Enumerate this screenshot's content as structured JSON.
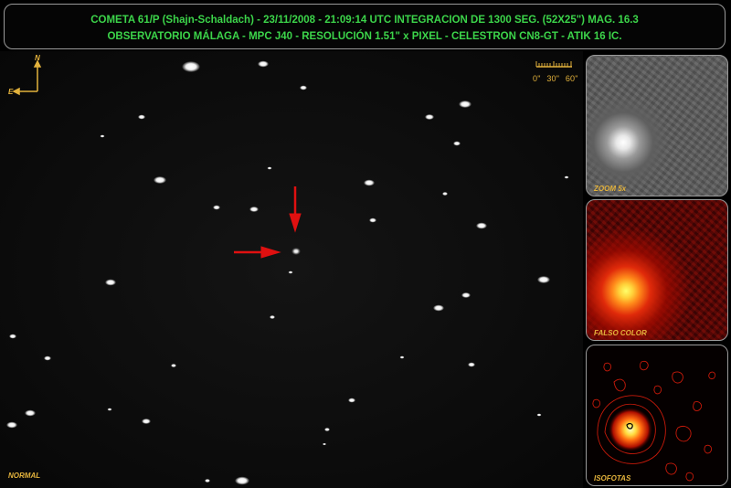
{
  "header": {
    "line1": "COMETA 61/P (Shajn-Schaldach) - 23/11/2008 - 21:09:14 UTC INTEGRACION DE 1300 SEG. (52X25\") MAG. 16.3",
    "line2": "OBSERVATORIO MÁLAGA  - MPC J40 - RESOLUCIÓN 1.51\" x PIXEL - CELESTRON CN8-GT - ATIK 16 IC."
  },
  "compass": {
    "north": "N",
    "east": "E"
  },
  "scale_bar": {
    "labels": [
      "0\"",
      "30\"",
      "60\""
    ]
  },
  "main_image": {
    "label": "NORMAL"
  },
  "panels": [
    {
      "id": "zoom",
      "label": "ZOOM 5x"
    },
    {
      "id": "falso",
      "label": "FALSO COLOR"
    },
    {
      "id": "iso",
      "label": "ISOFOTAS"
    }
  ],
  "colors": {
    "header_text": "#3cd44a",
    "label_text": "#e3b23c",
    "arrow": "#e01010",
    "border": "#9a9a9a"
  }
}
